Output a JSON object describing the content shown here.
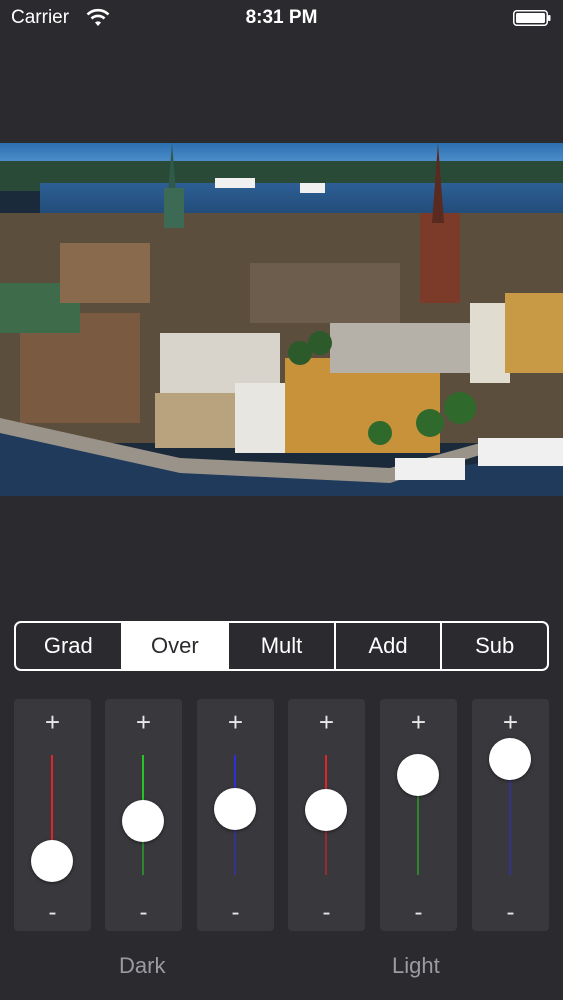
{
  "status_bar": {
    "carrier": "Carrier",
    "time": "8:31 PM",
    "wifi_icon": "wifi-icon",
    "battery_icon": "battery-icon"
  },
  "image": {
    "description_icon": "city-photo"
  },
  "blend_modes": {
    "selected": "Over",
    "segments": [
      "Grad",
      "Over",
      "Mult",
      "Add",
      "Sub"
    ]
  },
  "sliders": [
    {
      "plus": "+",
      "minus": "-",
      "color": "#e0242a",
      "level": 0.12
    },
    {
      "plus": "+",
      "minus": "-",
      "color": "#26c426",
      "level": 0.45
    },
    {
      "plus": "+",
      "minus": "-",
      "color": "#2f2fd8",
      "level": 0.55
    },
    {
      "plus": "+",
      "minus": "-",
      "color": "#e0242a",
      "level": 0.54
    },
    {
      "plus": "+",
      "minus": "-",
      "color": "#26c426",
      "level": 0.83
    },
    {
      "plus": "+",
      "minus": "-",
      "color": "#2f2fd8",
      "level": 0.97
    }
  ],
  "labels": {
    "dark": "Dark",
    "light": "Light"
  }
}
